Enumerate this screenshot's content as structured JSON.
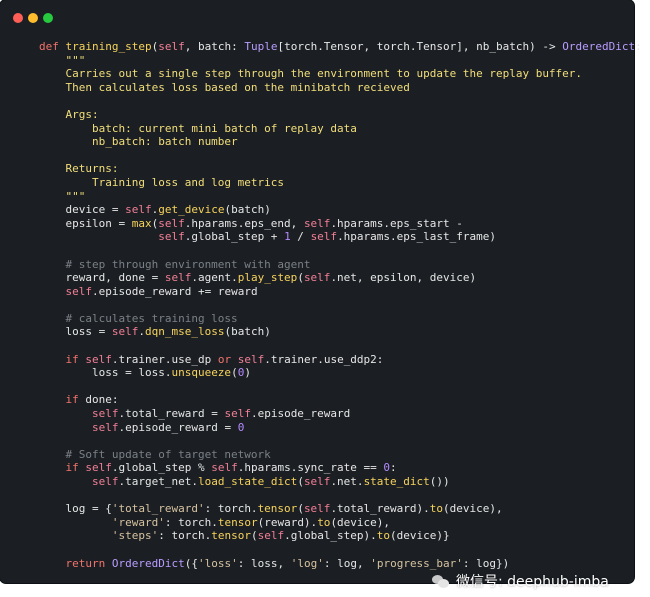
{
  "window": {
    "title_buttons": [
      "close",
      "minimize",
      "zoom"
    ],
    "colors": {
      "background": "#1b1f23",
      "keyword": "#f1736b",
      "function": "#f7d35c",
      "self": "#f47f96",
      "comment": "#7b8087"
    }
  },
  "code_lines": [
    "def training_step(self, batch: Tuple[torch.Tensor, torch.Tensor], nb_batch) -> OrderedDict:",
    "    \"\"\"",
    "    Carries out a single step through the environment to update the replay buffer.",
    "    Then calculates loss based on the minibatch recieved",
    "",
    "    Args:",
    "        batch: current mini batch of replay data",
    "        nb_batch: batch number",
    "",
    "    Returns:",
    "        Training loss and log metrics",
    "    \"\"\"",
    "    device = self.get_device(batch)",
    "    epsilon = max(self.hparams.eps_end, self.hparams.eps_start -",
    "                  self.global_step + 1 / self.hparams.eps_last_frame)",
    "",
    "    # step through environment with agent",
    "    reward, done = self.agent.play_step(self.net, epsilon, device)",
    "    self.episode_reward += reward",
    "",
    "    # calculates training loss",
    "    loss = self.dqn_mse_loss(batch)",
    "",
    "    if self.trainer.use_dp or self.trainer.use_ddp2:",
    "        loss = loss.unsqueeze(0)",
    "",
    "    if done:",
    "        self.total_reward = self.episode_reward",
    "        self.episode_reward = 0",
    "",
    "    # Soft update of target network",
    "    if self.global_step % self.hparams.sync_rate == 0:",
    "        self.target_net.load_state_dict(self.net.state_dict())",
    "",
    "    log = {'total_reward': torch.tensor(self.total_reward).to(device),",
    "           'reward': torch.tensor(reward).to(device),",
    "           'steps': torch.tensor(self.global_step).to(device)}",
    "",
    "    return OrderedDict({'loss': loss, 'log': log, 'progress_bar': log})"
  ],
  "watermark": {
    "text": "微信号: deephub-imba",
    "icon": "wechat-icon"
  }
}
